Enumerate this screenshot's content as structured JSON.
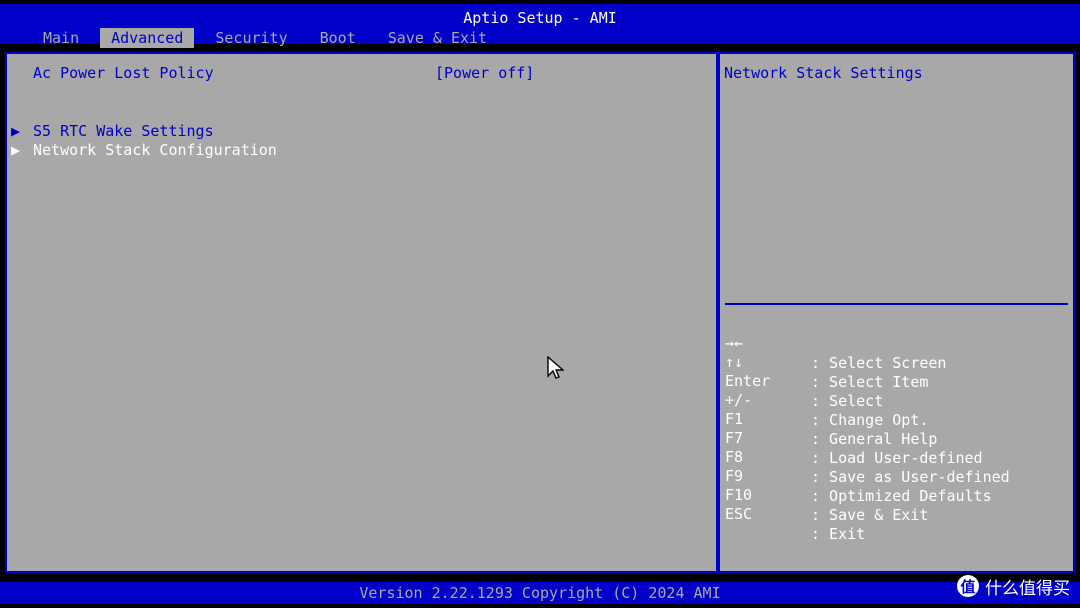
{
  "window": {
    "title": "Aptio Setup - AMI"
  },
  "tabs": [
    {
      "label": "Main"
    },
    {
      "label": "Advanced"
    },
    {
      "label": "Security"
    },
    {
      "label": "Boot"
    },
    {
      "label": "Save & Exit"
    }
  ],
  "active_tab": "Advanced",
  "settings": {
    "ac_power_lost_policy": {
      "label": "Ac Power Lost Policy",
      "value": "[Power off]"
    },
    "submenus": [
      {
        "arrow": "▶",
        "label": "S5 RTC Wake Settings"
      },
      {
        "arrow": "▶",
        "label": "Network Stack Configuration"
      }
    ]
  },
  "help": {
    "title": "Network Stack Settings",
    "keys": [
      {
        "key": "→←",
        "desc": ": Select Screen"
      },
      {
        "key": "↑↓",
        "desc": ": Select Item"
      },
      {
        "key": "Enter",
        "desc": ": Select"
      },
      {
        "key": "+/-",
        "desc": ": Change Opt."
      },
      {
        "key": "F1",
        "desc": ": General Help"
      },
      {
        "key": "F7",
        "desc": ": Load User-defined"
      },
      {
        "key": "F8",
        "desc": ": Save as User-defined"
      },
      {
        "key": "F9",
        "desc": ": Optimized Defaults"
      },
      {
        "key": "F10",
        "desc": ": Save & Exit"
      },
      {
        "key": "ESC",
        "desc": ": Exit"
      }
    ]
  },
  "footer": {
    "version": "Version 2.22.1293 Copyright (C) 2024 AMI"
  },
  "watermark": {
    "icon_text": "值",
    "label": "什么值得买"
  },
  "colors": {
    "blue": "#0000c8",
    "gray": "#a8a8a8",
    "white": "#ffffff",
    "black": "#000000"
  },
  "icons": {
    "cursor": "mouse-pointer-icon",
    "submenu_arrow": "triangle-right-icon",
    "watermark_icon": "smzdm-logo-icon"
  }
}
